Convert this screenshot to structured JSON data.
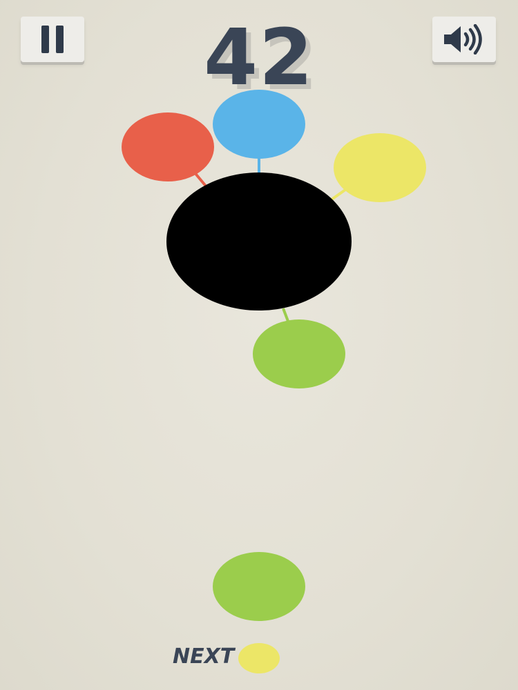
{
  "hud": {
    "pause_icon": "pause-icon",
    "sound_icon": "speaker-icon",
    "score": "42"
  },
  "game": {
    "core_color": "#000000",
    "attached_balls": [
      {
        "name": "red",
        "color": "#e8604a"
      },
      {
        "name": "blue",
        "color": "#5ab4e8"
      },
      {
        "name": "yellow",
        "color": "#ece667"
      },
      {
        "name": "green",
        "color": "#9bcd4c"
      }
    ],
    "current_ball_color": "#9bcd4c"
  },
  "next": {
    "label": "NEXT",
    "color": "#ece667"
  }
}
